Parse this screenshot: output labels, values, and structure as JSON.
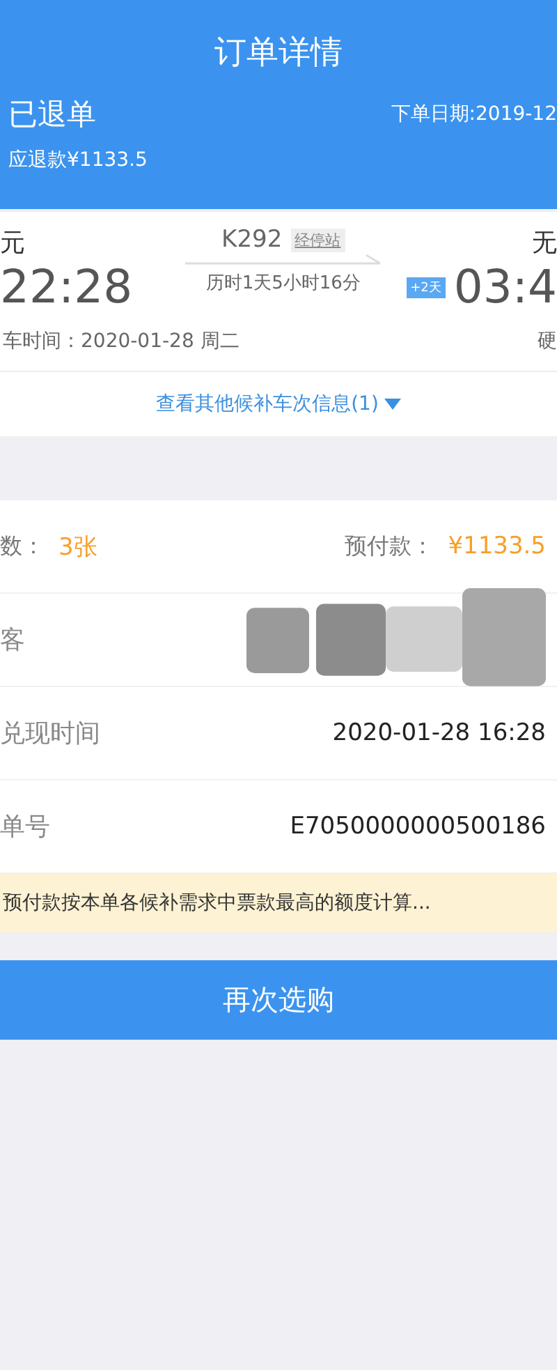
{
  "window": {
    "title": "订单详情"
  },
  "status": {
    "label": "已退单",
    "order_date": "下单日期:2019-12",
    "refund": "应退款¥1133.5"
  },
  "trip": {
    "from_station": "元",
    "depart_time": "22:28",
    "train_no": "K292",
    "stops_link": "经停站",
    "duration": "历时1天5小时16分",
    "day_offset": "+2天",
    "to_station": "无",
    "arrive_time": "03:4",
    "ride_date": "车时间：2020-01-28 周二",
    "seat": "硬",
    "more_link": "查看其他候补车次信息(1)",
    "expanded": false
  },
  "details": [
    {
      "kind": "pair",
      "label": "数：",
      "value": "3张",
      "label_2": "预付款：",
      "value_2": "¥1133.5"
    },
    {
      "kind": "redacted",
      "label": "客"
    },
    {
      "kind": "plain",
      "label": "兑现时间",
      "value": "2020-01-28 16:28"
    },
    {
      "kind": "plain",
      "label": "单号",
      "value": "E7050000000500186"
    }
  ],
  "tip": "预付款按本单各候补需求中票款最高的额度计算...",
  "buttons": [
    "再次选购"
  ]
}
